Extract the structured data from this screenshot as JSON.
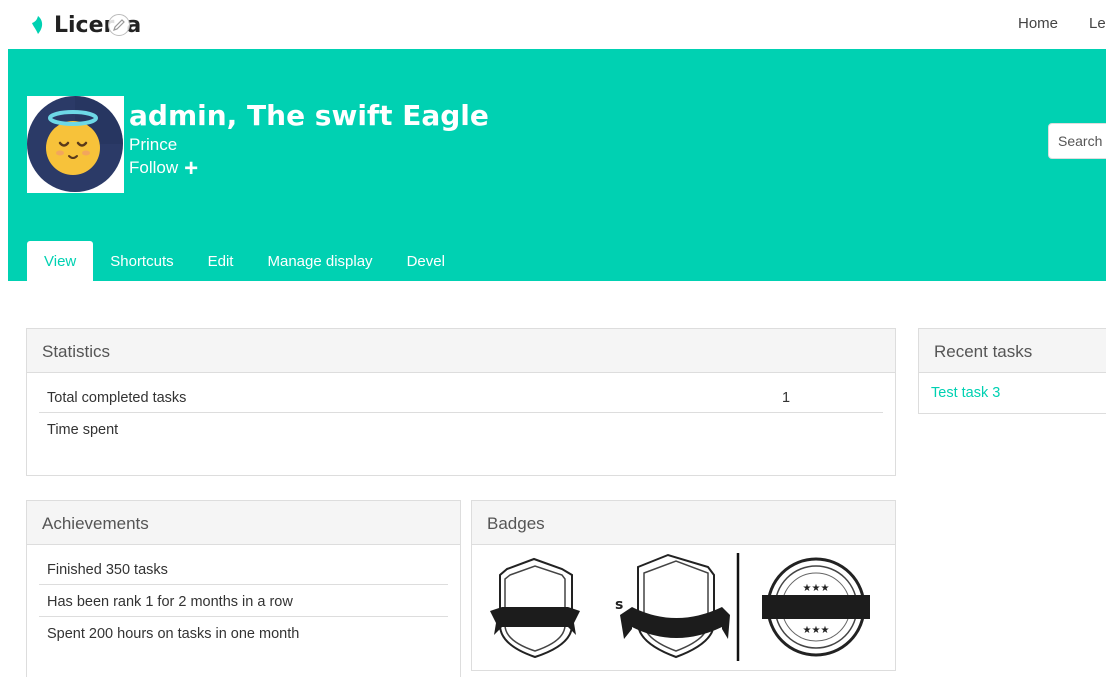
{
  "brand": {
    "name": "Licer",
    "name_tail": "a"
  },
  "nav": {
    "items": [
      "Home",
      "Le"
    ]
  },
  "profile": {
    "name": "admin, The swift Eagle",
    "rank": "Prince",
    "follow_label": "Follow",
    "follow_icon": "plus-icon"
  },
  "search": {
    "placeholder": "Search"
  },
  "tabs": [
    {
      "label": "View",
      "active": true
    },
    {
      "label": "Shortcuts"
    },
    {
      "label": "Edit"
    },
    {
      "label": "Manage display"
    },
    {
      "label": "Devel"
    }
  ],
  "statistics": {
    "title": "Statistics",
    "rows": [
      {
        "label": "Total completed tasks",
        "value": "1"
      },
      {
        "label": "Time spent",
        "value": ""
      }
    ]
  },
  "recent_tasks": {
    "title": "Recent tasks",
    "items": [
      "Test task 3"
    ]
  },
  "achievements": {
    "title": "Achievements",
    "items": [
      "Finished 350 tasks",
      "Has been rank 1 for 2 months in a row",
      "Spent 200 hours on tasks in one month"
    ]
  },
  "badges": {
    "title": "Badges",
    "items": [
      "shield-ribbon-badge",
      "shield-ribbon-badge",
      "round-star-badge"
    ]
  },
  "colors": {
    "accent": "#00d1b2",
    "panel_heading": "#f5f5f5",
    "border": "#dddddd"
  }
}
